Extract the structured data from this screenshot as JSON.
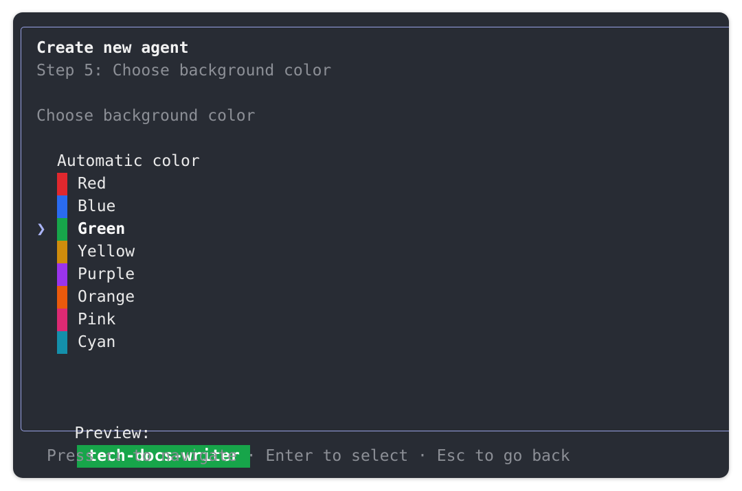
{
  "dialog": {
    "title": "Create new agent",
    "subtitle": "Step 5: Choose background color",
    "prompt": "Choose background color"
  },
  "options": {
    "cursor_glyph": "❯",
    "selected_index": 3,
    "items": [
      {
        "label": "Automatic color",
        "color": null
      },
      {
        "label": "Red",
        "color": "#e0282e"
      },
      {
        "label": "Blue",
        "color": "#2a6bf0"
      },
      {
        "label": "Green",
        "color": "#17a54a"
      },
      {
        "label": "Yellow",
        "color": "#cf8c0c"
      },
      {
        "label": "Purple",
        "color": "#9b34ec"
      },
      {
        "label": "Orange",
        "color": "#ea5a0c"
      },
      {
        "label": "Pink",
        "color": "#dc2a73"
      },
      {
        "label": "Cyan",
        "color": "#1490ab"
      }
    ]
  },
  "preview": {
    "label": "Preview:",
    "agent_name": "tech-docs-writer",
    "color": "#17a54a"
  },
  "footer": {
    "hint": "Press ↑↓ to navigate · Enter to select · Esc to go back"
  },
  "colors": {
    "background": "#282c34",
    "border": "#9aa3e6",
    "muted_text": "#8c8f96"
  }
}
